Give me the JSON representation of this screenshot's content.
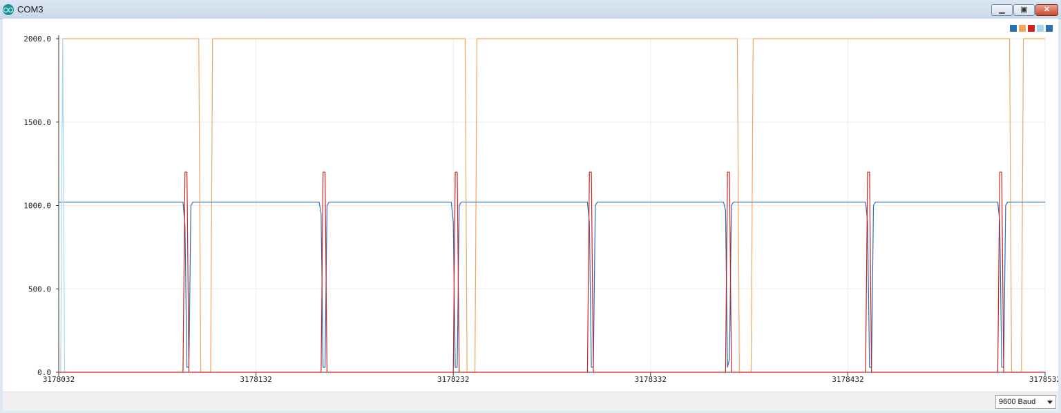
{
  "window": {
    "title": "COM3",
    "min_glyph": "▁",
    "max_glyph": "▣",
    "close_glyph": "✕"
  },
  "statusbar": {
    "baud_value": "9600 Baud"
  },
  "colors": {
    "background": "#ffffff",
    "grid": "#ebebeb",
    "axis": "#333333",
    "series": [
      "#2a6fb0",
      "#f2a65a",
      "#cc2222",
      "#a8d8f0",
      "#2a6fb0"
    ]
  },
  "chart_data": {
    "type": "line",
    "grid": true,
    "legend": "top-right",
    "xlim": [
      3178032,
      3178532
    ],
    "ylim": [
      0,
      2000
    ],
    "xticks": [
      3178032,
      3178132,
      3178232,
      3178332,
      3178432,
      3178532
    ],
    "xtick_labels": [
      "3178032",
      "3178132",
      "3178232",
      "3178332",
      "3178432",
      "3178532"
    ],
    "yticks": [
      0,
      500,
      1000,
      1500,
      2000
    ],
    "ytick_labels": [
      "0.0",
      "500.0",
      "1000.0",
      "1500.0",
      "2000.0"
    ],
    "series": [
      {
        "color": "#2a6fb0",
        "points": [
          [
            3178032,
            1020
          ],
          [
            3178095,
            1020
          ],
          [
            3178096,
            880
          ],
          [
            3178097,
            30
          ],
          [
            3178098,
            30
          ],
          [
            3178099,
            1000
          ],
          [
            3178100,
            1020
          ],
          [
            3178164,
            1020
          ],
          [
            3178165,
            950
          ],
          [
            3178166,
            30
          ],
          [
            3178167,
            30
          ],
          [
            3178168,
            1000
          ],
          [
            3178169,
            1020
          ],
          [
            3178231,
            1020
          ],
          [
            3178232,
            900
          ],
          [
            3178233,
            30
          ],
          [
            3178234,
            30
          ],
          [
            3178235,
            1000
          ],
          [
            3178236,
            1020
          ],
          [
            3178300,
            1020
          ],
          [
            3178301,
            900
          ],
          [
            3178302,
            30
          ],
          [
            3178303,
            30
          ],
          [
            3178304,
            1000
          ],
          [
            3178305,
            1020
          ],
          [
            3178369,
            1020
          ],
          [
            3178370,
            970
          ],
          [
            3178371,
            30
          ],
          [
            3178372,
            80
          ],
          [
            3178373,
            1000
          ],
          [
            3178374,
            1020
          ],
          [
            3178441,
            1020
          ],
          [
            3178442,
            900
          ],
          [
            3178443,
            30
          ],
          [
            3178444,
            30
          ],
          [
            3178445,
            1000
          ],
          [
            3178446,
            1020
          ],
          [
            3178508,
            1020
          ],
          [
            3178509,
            900
          ],
          [
            3178510,
            30
          ],
          [
            3178511,
            30
          ],
          [
            3178512,
            1000
          ],
          [
            3178513,
            1020
          ],
          [
            3178532,
            1020
          ]
        ]
      },
      {
        "color": "#f2a65a",
        "points": [
          [
            3178034,
            2000
          ],
          [
            3178103,
            2000
          ],
          [
            3178104,
            0
          ],
          [
            3178109,
            0
          ],
          [
            3178110,
            2000
          ],
          [
            3178238,
            2000
          ],
          [
            3178239,
            0
          ],
          [
            3178243,
            0
          ],
          [
            3178244,
            2000
          ],
          [
            3178376,
            2000
          ],
          [
            3178377,
            0
          ],
          [
            3178383,
            0
          ],
          [
            3178384,
            2000
          ],
          [
            3178514,
            2000
          ],
          [
            3178515,
            0
          ],
          [
            3178520,
            0
          ],
          [
            3178521,
            2000
          ],
          [
            3178532,
            2000
          ]
        ]
      },
      {
        "color": "#cc2222",
        "points": [
          [
            3178032,
            0
          ],
          [
            3178095,
            0
          ],
          [
            3178096,
            1200
          ],
          [
            3178097,
            1200
          ],
          [
            3178098,
            0
          ],
          [
            3178165,
            0
          ],
          [
            3178166,
            1200
          ],
          [
            3178167,
            1200
          ],
          [
            3178168,
            0
          ],
          [
            3178232,
            0
          ],
          [
            3178233,
            1200
          ],
          [
            3178234,
            1200
          ],
          [
            3178235,
            0
          ],
          [
            3178300,
            0
          ],
          [
            3178301,
            1200
          ],
          [
            3178302,
            1200
          ],
          [
            3178303,
            0
          ],
          [
            3178370,
            0
          ],
          [
            3178371,
            1200
          ],
          [
            3178372,
            1200
          ],
          [
            3178373,
            0
          ],
          [
            3178441,
            0
          ],
          [
            3178442,
            1200
          ],
          [
            3178443,
            1200
          ],
          [
            3178444,
            0
          ],
          [
            3178508,
            0
          ],
          [
            3178509,
            1200
          ],
          [
            3178510,
            1200
          ],
          [
            3178511,
            0
          ],
          [
            3178532,
            0
          ]
        ]
      },
      {
        "color": "#a8d8f0",
        "points": [
          [
            3178033,
            0
          ],
          [
            3178034,
            2000
          ],
          [
            3178035,
            0
          ],
          [
            3178036,
            0
          ]
        ]
      },
      {
        "color": "#2a6fb0",
        "points": []
      }
    ]
  }
}
